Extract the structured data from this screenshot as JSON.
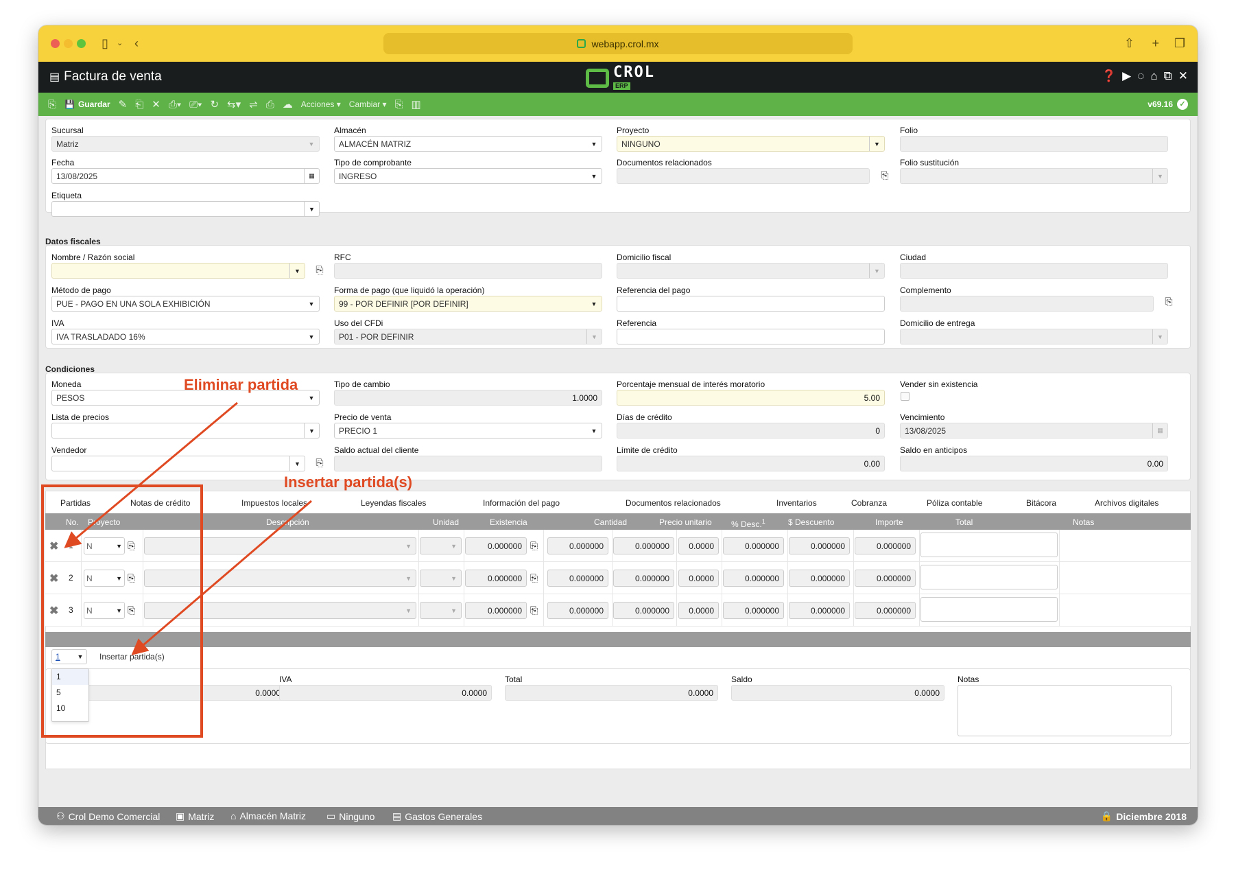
{
  "browser": {
    "url": "webapp.crol.mx"
  },
  "app": {
    "title": "Factura de venta",
    "logo_text": "CROL",
    "logo_sub": "ERP",
    "version": "v69.16"
  },
  "toolbar": {
    "save_label": "Guardar",
    "acciones_label": "Acciones",
    "cambiar_label": "Cambiar"
  },
  "general": {
    "sucursal_label": "Sucursal",
    "sucursal_value": "Matriz",
    "almacen_label": "Almacén",
    "almacen_value": "ALMACÉN MATRIZ",
    "proyecto_label": "Proyecto",
    "proyecto_value": "NINGUNO",
    "folio_label": "Folio",
    "folio_value": "",
    "fecha_label": "Fecha",
    "fecha_value": "13/08/2025",
    "tipo_comprobante_label": "Tipo de comprobante",
    "tipo_comprobante_value": "INGRESO",
    "docs_rel_label": "Documentos relacionados",
    "docs_rel_value": "",
    "folio_sust_label": "Folio sustitución",
    "folio_sust_value": "",
    "etiqueta_label": "Etiqueta",
    "etiqueta_value": ""
  },
  "fiscal": {
    "section_title": "Datos fiscales",
    "nombre_label": "Nombre / Razón social",
    "nombre_value": "",
    "rfc_label": "RFC",
    "rfc_value": "",
    "domicilio_label": "Domicilio fiscal",
    "domicilio_value": "",
    "ciudad_label": "Ciudad",
    "ciudad_value": "",
    "metodo_label": "Método de pago",
    "metodo_value": "PUE - PAGO EN UNA SOLA EXHIBICIÓN",
    "forma_label": "Forma de pago (que liquidó la operación)",
    "forma_value": "99 - POR DEFINIR [POR DEFINIR]",
    "ref_pago_label": "Referencia del pago",
    "ref_pago_value": "",
    "complemento_label": "Complemento",
    "complemento_value": "",
    "iva_label": "IVA",
    "iva_value": "IVA TRASLADADO 16%",
    "uso_label": "Uso del CFDi",
    "uso_value": "P01 - POR DEFINIR",
    "referencia_label": "Referencia",
    "referencia_value": "",
    "dom_entrega_label": "Domicilio de entrega",
    "dom_entrega_value": ""
  },
  "condiciones": {
    "section_title": "Condiciones",
    "moneda_label": "Moneda",
    "moneda_value": "PESOS",
    "tipo_cambio_label": "Tipo de cambio",
    "tipo_cambio_value": "1.0000",
    "interes_label": "Porcentaje mensual de interés moratorio",
    "interes_value": "5.00",
    "vender_label": "Vender sin existencia",
    "lista_label": "Lista de precios",
    "lista_value": "",
    "precio_label": "Precio de venta",
    "precio_value": "PRECIO 1",
    "dias_label": "Días de crédito",
    "dias_value": "0",
    "venc_label": "Vencimiento",
    "venc_value": "13/08/2025",
    "vendedor_label": "Vendedor",
    "vendedor_value": "",
    "saldo_cliente_label": "Saldo actual del cliente",
    "saldo_cliente_value": "",
    "limite_label": "Límite de crédito",
    "limite_value": "0.00",
    "anticipos_label": "Saldo en anticipos",
    "anticipos_value": "0.00"
  },
  "tabs": [
    "Partidas",
    "Notas de crédito",
    "Impuestos locales",
    "Leyendas fiscales",
    "Información del pago",
    "Documentos relacionados",
    "Inventarios",
    "Cobranza",
    "Póliza contable",
    "Bitácora",
    "Archivos digitales"
  ],
  "grid": {
    "columns": [
      "No.",
      "Proyecto",
      "Descripción",
      "Unidad",
      "Existencia",
      "Cantidad",
      "Precio unitario",
      "% Desc.",
      "$ Descuento",
      "Importe",
      "Total",
      "Notas"
    ],
    "desc_sup": "1",
    "rows": [
      {
        "no": "1",
        "proyecto": "N",
        "existencia": "0.000000",
        "cantidad": "0.000000",
        "precio": "0.000000",
        "desc_pct": "0.0000",
        "descuento": "0.000000",
        "importe": "0.000000",
        "total": "0.000000"
      },
      {
        "no": "2",
        "proyecto": "N",
        "existencia": "0.000000",
        "cantidad": "0.000000",
        "precio": "0.000000",
        "desc_pct": "0.0000",
        "descuento": "0.000000",
        "importe": "0.000000",
        "total": "0.000000"
      },
      {
        "no": "3",
        "proyecto": "N",
        "existencia": "0.000000",
        "cantidad": "0.000000",
        "precio": "0.000000",
        "desc_pct": "0.0000",
        "descuento": "0.000000",
        "importe": "0.000000",
        "total": "0.000000"
      }
    ],
    "insert_count": "1",
    "insert_label": "Insertar partida(s)",
    "insert_options": [
      "1",
      "5",
      "10"
    ]
  },
  "totals": {
    "subtotal_value": "0.0000",
    "iva_label": "IVA",
    "iva_value": "0.0000",
    "total_label": "Total",
    "total_value": "0.0000",
    "saldo_label": "Saldo",
    "saldo_value": "0.0000",
    "notas_label": "Notas"
  },
  "annotations": {
    "eliminar": "Eliminar partida",
    "insertar": "Insertar partida(s)",
    "color": "#e04a23"
  },
  "statusbar": {
    "empresa": "Crol Demo Comercial",
    "sucursal": "Matriz",
    "almacen": "Almacén Matriz",
    "proyecto": "Ninguno",
    "centro": "Gastos Generales",
    "periodo": "Diciembre 2018"
  },
  "colors": {
    "titlebar": "#f7d23c",
    "appbar": "#191d1d",
    "toolbar": "#5fb248",
    "accent": "#5dbb46"
  }
}
